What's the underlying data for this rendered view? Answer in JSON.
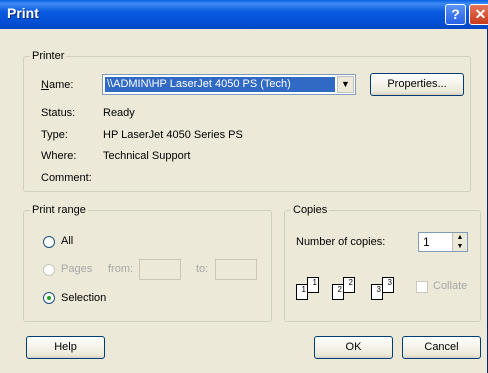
{
  "window": {
    "title": "Print"
  },
  "titlebar": {
    "help_glyph": "?",
    "close_glyph": "✕"
  },
  "printer": {
    "group_label": "Printer",
    "name_label": "Name:",
    "name_value": "\\\\ADMIN\\HP LaserJet 4050 PS (Tech)",
    "properties_label": "Properties...",
    "status_label": "Status:",
    "status_value": "Ready",
    "type_label": "Type:",
    "type_value": "HP LaserJet 4050 Series PS",
    "where_label": "Where:",
    "where_value": "Technical Support",
    "comment_label": "Comment:"
  },
  "print_range": {
    "group_label": "Print range",
    "all_label": "All",
    "pages_label": "Pages",
    "from_label": "from:",
    "to_label": "to:",
    "selection_label": "Selection",
    "selected": "Selection"
  },
  "copies": {
    "group_label": "Copies",
    "number_label": "Number of copies:",
    "number_value": "1",
    "collate_label": "Collate",
    "collate_checked": false
  },
  "footer": {
    "help_label": "Help",
    "ok_label": "OK",
    "cancel_label": "Cancel"
  }
}
